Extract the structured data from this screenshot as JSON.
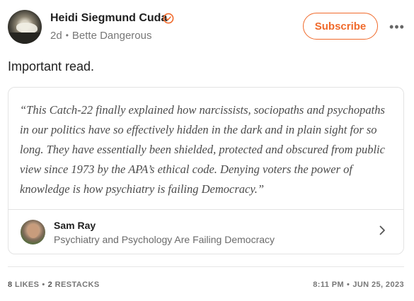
{
  "post": {
    "author_name": "Heidi Siegmund Cuda",
    "age": "2d",
    "publication": "Bette Dangerous",
    "subscribe_label": "Subscribe",
    "more_label": "•••",
    "text": "Important read."
  },
  "quote_card": {
    "quote": "“This Catch-22 finally explained how narcissists, sociopaths and psychopaths in our politics have so effectively hidden in the dark and in plain sight for so long. They have essentially been shielded, protected and obscured from public view since 1973 by the APA’s ethical code. Denying voters the power of knowledge is how psychiatry is failing Democracy.”",
    "ref_author": "Sam Ray",
    "ref_title": "Psychiatry and Psychology Are Failing Democracy"
  },
  "footer": {
    "likes_count": "8",
    "likes_label": "LIKES",
    "restacks_count": "2",
    "restacks_label": "RESTACKS",
    "time": "8:11 PM",
    "date": "JUN 25, 2023"
  },
  "colors": {
    "accent": "#f06a2b",
    "text": "#1f1f1f",
    "muted": "#777777"
  },
  "icons": {
    "verified": "verified-badge-icon",
    "more": "more-horizontal-icon",
    "chevron": "chevron-right-icon"
  }
}
